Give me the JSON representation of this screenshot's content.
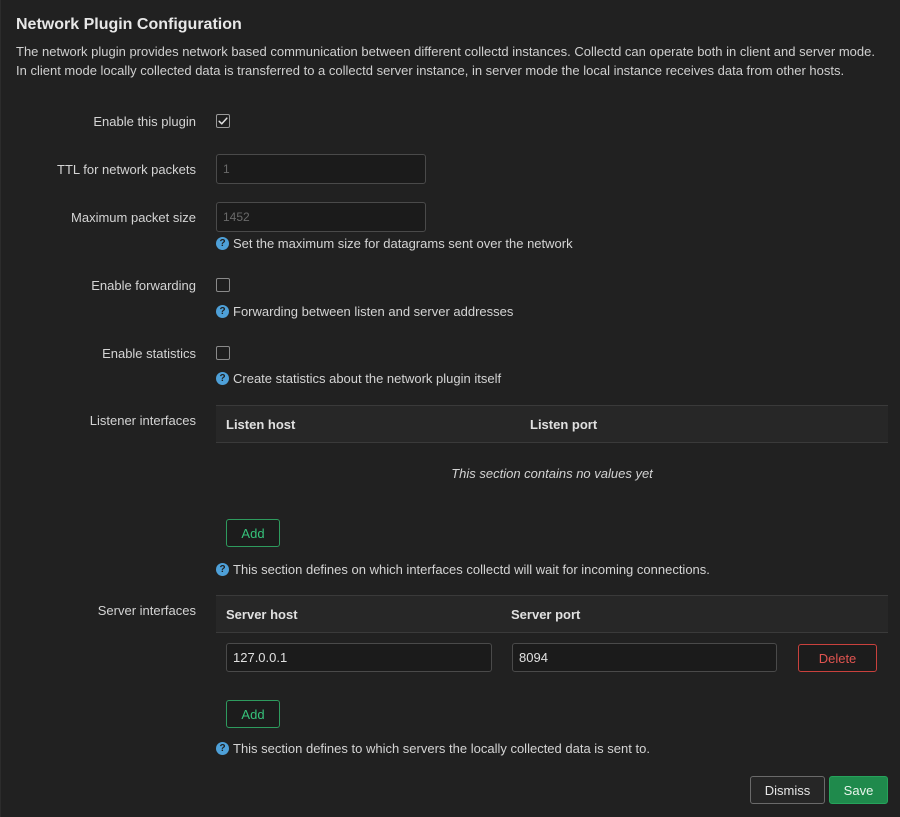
{
  "dialog": {
    "title": "Network Plugin Configuration",
    "description": "The network plugin provides network based communication between different collectd instances. Collectd can operate both in client and server mode. In client mode locally collected data is transferred to a collectd server instance, in server mode the local instance receives data from other hosts."
  },
  "fields": {
    "enable_plugin": {
      "label": "Enable this plugin",
      "checked": true
    },
    "ttl": {
      "label": "TTL for network packets",
      "placeholder": "1",
      "value": ""
    },
    "max_packet": {
      "label": "Maximum packet size",
      "placeholder": "1452",
      "value": "",
      "help": "Set the maximum size for datagrams sent over the network"
    },
    "forwarding": {
      "label": "Enable forwarding",
      "checked": false,
      "help": "Forwarding between listen and server addresses"
    },
    "statistics": {
      "label": "Enable statistics",
      "checked": false,
      "help": "Create statistics about the network plugin itself"
    }
  },
  "listener": {
    "label": "Listener interfaces",
    "columns": [
      "Listen host",
      "Listen port"
    ],
    "empty_message": "This section contains no values yet",
    "add_label": "Add",
    "help": "This section defines on which interfaces collectd will wait for incoming connections."
  },
  "server": {
    "label": "Server interfaces",
    "columns": [
      "Server host",
      "Server port"
    ],
    "rows": [
      {
        "host": "127.0.0.1",
        "port": "8094",
        "delete_label": "Delete"
      }
    ],
    "add_label": "Add",
    "help": "This section defines to which servers the locally collected data is sent to."
  },
  "footer": {
    "dismiss_label": "Dismiss",
    "save_label": "Save"
  },
  "colors": {
    "accent_green": "#36c27a",
    "danger_red": "#e05450",
    "help_blue": "#4ea0d8"
  },
  "icons": [
    "help-icon",
    "checkmark-icon"
  ]
}
